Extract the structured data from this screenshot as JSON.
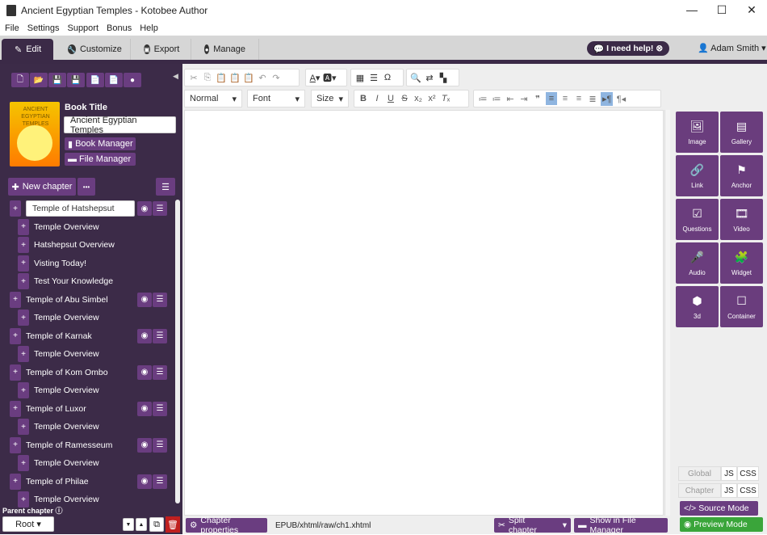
{
  "window": {
    "title": "Ancient Egyptian Temples - Kotobee Author",
    "minimize": "—",
    "maximize": "☐",
    "close": "✕"
  },
  "menu": [
    "File",
    "Settings",
    "Support",
    "Bonus",
    "Help"
  ],
  "tabs": [
    {
      "label": "Edit",
      "icon": "✎"
    },
    {
      "label": "Customize",
      "icon": "🔧"
    },
    {
      "label": "Export",
      "icon": "▣"
    },
    {
      "label": "Manage",
      "icon": "👤"
    }
  ],
  "help": {
    "label": "I need help!",
    "icon": "💬"
  },
  "user": {
    "name": "Adam Smith",
    "icon": "👤"
  },
  "file_toolbar": [
    "new-file",
    "open-folder",
    "save",
    "save-as",
    "export-pdf",
    "import-file",
    "globe"
  ],
  "book": {
    "title_label": "Book Title",
    "title_value": "Ancient Egyptian Temples",
    "cover_text": "ANCIENT EGYPTIAN TEMPLES",
    "book_manager": "Book Manager",
    "file_manager": "File Manager"
  },
  "chapters": {
    "new_chapter": "New chapter",
    "more": "•••",
    "items": [
      {
        "label": "Temple of Hatshepsut",
        "level": 0,
        "editing": true
      },
      {
        "label": "Temple Overview",
        "level": 1
      },
      {
        "label": "Hatshepsut Overview",
        "level": 1
      },
      {
        "label": "Visting Today!",
        "level": 1
      },
      {
        "label": "Test Your Knowledge",
        "level": 1
      },
      {
        "label": "Temple of Abu Simbel",
        "level": 0
      },
      {
        "label": "Temple Overview",
        "level": 1
      },
      {
        "label": "Temple of Karnak",
        "level": 0
      },
      {
        "label": "Temple Overview",
        "level": 1
      },
      {
        "label": "Temple of Kom Ombo",
        "level": 0
      },
      {
        "label": "Temple Overview",
        "level": 1
      },
      {
        "label": "Temple of Luxor",
        "level": 0
      },
      {
        "label": "Temple Overview",
        "level": 1
      },
      {
        "label": "Temple of Ramesseum",
        "level": 0
      },
      {
        "label": "Temple Overview",
        "level": 1
      },
      {
        "label": "Temple of Philae",
        "level": 0
      },
      {
        "label": "Temple Overview",
        "level": 1
      }
    ]
  },
  "parent": {
    "label": "Parent chapter",
    "value": "Root"
  },
  "editor": {
    "format": "Normal",
    "font": "Font",
    "size": "Size",
    "path": "EPUB/xhtml/raw/ch1.xhtml",
    "chapter_properties": "Chapter properties",
    "split_chapter": "Split chapter",
    "show_in_file_manager": "Show in File Manager"
  },
  "widgets": [
    {
      "label": "Image",
      "icon": "🖼"
    },
    {
      "label": "Gallery",
      "icon": "▤"
    },
    {
      "label": "Link",
      "icon": "🔗"
    },
    {
      "label": "Anchor",
      "icon": "⚑"
    },
    {
      "label": "Questions",
      "icon": "☑"
    },
    {
      "label": "Video",
      "icon": "🎞"
    },
    {
      "label": "Audio",
      "icon": "🎤"
    },
    {
      "label": "Widget",
      "icon": "🧩"
    },
    {
      "label": "3d",
      "icon": "⬢"
    },
    {
      "label": "Container",
      "icon": "☐"
    }
  ],
  "code": {
    "global": "Global",
    "chapter": "Chapter",
    "js": "JS",
    "css": "CSS",
    "source_mode": "Source Mode",
    "preview_mode": "Preview Mode"
  },
  "colors": {
    "sidebar": "#3c2b48",
    "accent": "#6a3d80",
    "preview": "#3aa53a",
    "delete": "#c0201f"
  }
}
